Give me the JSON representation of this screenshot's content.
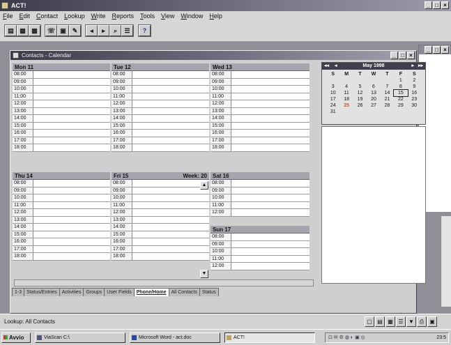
{
  "app": {
    "title": "ACT!"
  },
  "menu": [
    "File",
    "Edit",
    "Contact",
    "Lookup",
    "Write",
    "Reports",
    "Tools",
    "View",
    "Window",
    "Help"
  ],
  "window": {
    "title": "Contacts - Calendar"
  },
  "week_label": "Week: 20",
  "days_top": [
    {
      "label": "Mon 11",
      "times": [
        "08:00",
        "09:00",
        "10:00",
        "11:00",
        "12:00",
        "13:00",
        "14:00",
        "15:00",
        "16:00",
        "17:00",
        "18:00"
      ]
    },
    {
      "label": "Tue 12",
      "times": [
        "08:00",
        "09:00",
        "10:00",
        "11:00",
        "12:00",
        "13:00",
        "14:00",
        "15:00",
        "16:00",
        "17:00",
        "18:00"
      ]
    },
    {
      "label": "Wed 13",
      "times": [
        "08:00",
        "09:00",
        "10:00",
        "11:00",
        "12:00",
        "13:00",
        "14:00",
        "15:00",
        "16:00",
        "17:00",
        "18:00"
      ]
    }
  ],
  "days_bottom": [
    {
      "label": "Thu 14",
      "times": [
        "08:00",
        "09:00",
        "10:00",
        "11:00",
        "12:00",
        "13:00",
        "14:00",
        "15:00",
        "16:00",
        "17:00",
        "18:00"
      ]
    },
    {
      "label": "Fri 15",
      "times": [
        "08:00",
        "09:00",
        "10:00",
        "11:00",
        "12:00",
        "13:00",
        "14:00",
        "15:00",
        "16:00",
        "17:00",
        "18:00"
      ]
    }
  ],
  "saturday": {
    "label": "Sat 16",
    "times": [
      "08:00",
      "09:00",
      "10:00",
      "11:00",
      "12:00"
    ]
  },
  "sunday": {
    "label": "Sun 17",
    "times": [
      "08:00",
      "09:00",
      "10:00",
      "11:00",
      "12:00"
    ]
  },
  "mini_calendar": {
    "month": "May 1998",
    "weekdays": [
      "S",
      "M",
      "T",
      "W",
      "T",
      "F",
      "S"
    ],
    "weeks": [
      [
        "",
        "",
        "",
        "",
        "",
        "1",
        "2"
      ],
      [
        "3",
        "4",
        "5",
        "6",
        "7",
        "8",
        "9"
      ],
      [
        "10",
        "11",
        "12",
        "13",
        "14",
        "15",
        "16"
      ],
      [
        "17",
        "18",
        "19",
        "20",
        "21",
        "22",
        "23"
      ],
      [
        "24",
        "25",
        "26",
        "27",
        "28",
        "29",
        "30"
      ],
      [
        "31",
        "",
        "",
        "",
        "",
        "",
        ""
      ]
    ],
    "today": "25",
    "selected": "15"
  },
  "tabs": [
    {
      "label": "1-3",
      "active": false
    },
    {
      "label": "Status/Entries",
      "active": false
    },
    {
      "label": "Activities",
      "active": false
    },
    {
      "label": "Groups",
      "active": false
    },
    {
      "label": "User Fields",
      "active": false
    },
    {
      "label": "Phone/Home",
      "active": true
    },
    {
      "label": "All Contacts",
      "active": false
    },
    {
      "label": "Status",
      "active": false
    }
  ],
  "status": {
    "text": "Lookup: All Contacts"
  },
  "taskbar": {
    "start": "Avvio",
    "tasks": [
      {
        "label": "ViaScan C:\\",
        "pressed": false
      },
      {
        "label": "Microsoft Word - act.doc",
        "pressed": false
      },
      {
        "label": "ACT!",
        "pressed": true
      }
    ],
    "clock": "23:5"
  }
}
